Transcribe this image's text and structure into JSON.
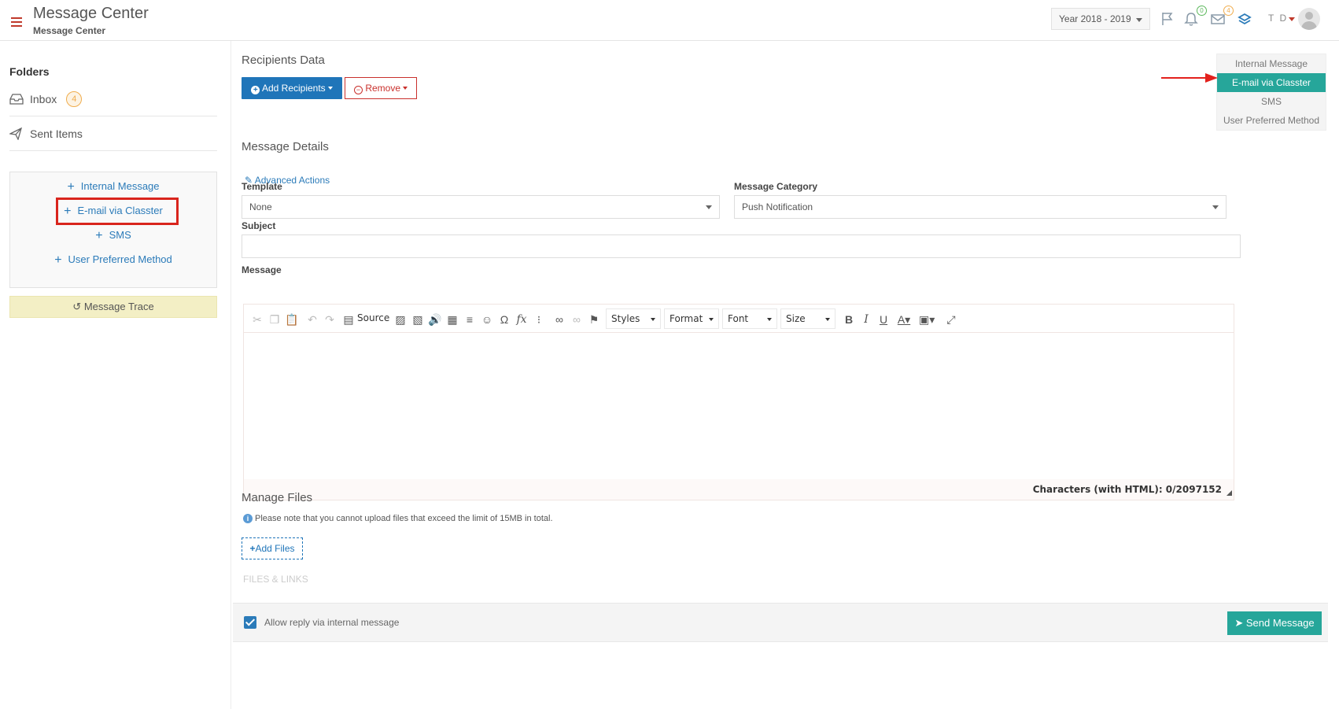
{
  "header": {
    "title": "Message Center",
    "subtitle": "Message Center",
    "year": "Year 2018 - 2019",
    "notifications_count": "0",
    "messages_count": "4",
    "user_initials": "T D"
  },
  "sidebar": {
    "folders_title": "Folders",
    "inbox_label": "Inbox",
    "inbox_count": "4",
    "sent_label": "Sent Items",
    "new_links": [
      "Internal Message",
      "E-mail via Classter",
      "SMS",
      "User Preferred Method"
    ],
    "trace_label": "Message Trace"
  },
  "recipients": {
    "title": "Recipients Data",
    "add_label": "Add Recipients",
    "remove_label": "Remove"
  },
  "methods": {
    "items": [
      "Internal Message",
      "E-mail via Classter",
      "SMS",
      "User Preferred Method"
    ],
    "active": "E-mail via Classter"
  },
  "details": {
    "title": "Message Details",
    "advanced_label": "Advanced Actions",
    "template_label": "Template",
    "template_value": "None",
    "category_label": "Message Category",
    "category_value": "Push Notification",
    "subject_label": "Subject",
    "subject_value": "",
    "message_label": "Message"
  },
  "editor": {
    "source_label": "Source",
    "styles_label": "Styles",
    "format_label": "Format",
    "font_label": "Font",
    "size_label": "Size",
    "char_count": "Characters (with HTML): 0/2097152"
  },
  "files": {
    "title": "Manage Files",
    "note": "Please note that you cannot upload files that exceed the limit of 15MB in total.",
    "add_label": "Add Files",
    "links_label": "FILES & LINKS"
  },
  "footer": {
    "allow_reply_label": "Allow reply via internal message",
    "allow_reply_checked": true,
    "send_label": "Send Message"
  },
  "colors": {
    "primary": "#1f75b9",
    "accent_green": "#26a69a",
    "danger": "#c9302c",
    "highlight_red": "#d9251d"
  }
}
